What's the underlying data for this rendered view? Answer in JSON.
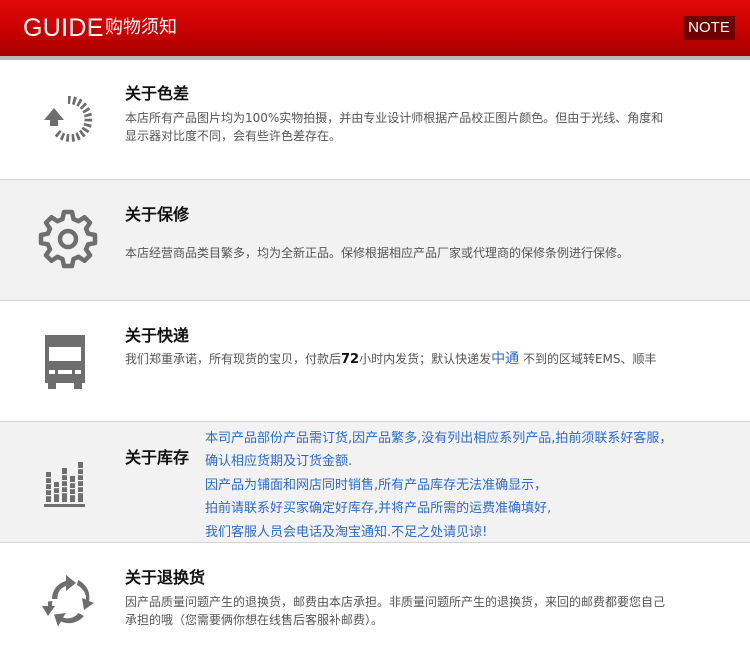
{
  "header": {
    "guide": "GUIDE",
    "title": "购物须知",
    "note": "NOTE"
  },
  "sections": [
    {
      "title": "关于色差",
      "text": "本店所有产品图片均为100%实物拍摄，并由专业设计师根据产品校正图片颜色。但由于光线、角度和显示器对比度不同，会有些许色差存在。",
      "icon": "refresh-arrow-icon"
    },
    {
      "title": "关于保修",
      "text": "本店经营商品类目繁多，均为全新正品。保修根据相应产品厂家或代理商的保修条例进行保修。",
      "icon": "gear-icon"
    },
    {
      "title": "关于快递",
      "text_part1": "我们郑重承诺，所有现货的宝贝，付款后",
      "text_highlight": "72",
      "text_part2": "小时内发货；默认快递发",
      "text_courier": "中通",
      "text_part3": " 不到的区域转EMS、顺丰",
      "icon": "truck-icon"
    },
    {
      "title": "关于库存",
      "lines": [
        "本司产品部份产品需订货,因产品繁多,没有列出相应系列产品,拍前须联系好客服，",
        "确认相应货期及订货金额.",
        "因产品为铺面和网店同时销售,所有产品库存无法准确显示，",
        "拍前请联系好买家确定好库存,并将产品所需的运费准确填好,",
        "我们客服人员会电话及淘宝通知.不足之处请见谅!"
      ],
      "icon": "bar-chart-icon"
    },
    {
      "title": "关于退换货",
      "text": "因产品质量问题产生的退换货，邮费由本店承担。非质量问题所产生的退换货，来回的邮费都要您自己承担的哦（您需要俩你想在线售后客服补邮费）。",
      "icon": "recycle-arrows-icon"
    }
  ],
  "colors": {
    "header_red": "#c80000",
    "note_bg": "#6d0000",
    "alt_bg": "#f2f2f2",
    "icon_gray": "#6e6e6e",
    "blue_text": "#2d6bc9"
  }
}
